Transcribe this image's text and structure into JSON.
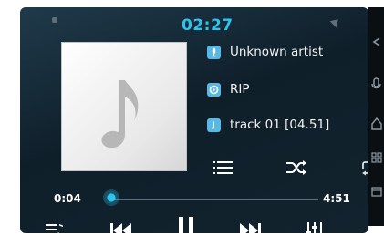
{
  "status": {
    "time": "02:27"
  },
  "track": {
    "artist": "Unknown artist",
    "album": "RIP",
    "title": "track 01 [04.51]"
  },
  "icons": {
    "playlist": "playlist-icon",
    "shuffle": "shuffle-icon",
    "repeat": "repeat-icon",
    "note": "music-note-icon"
  },
  "playback": {
    "elapsed": "0:04",
    "duration": "4:51",
    "progress_fraction": 0.014
  },
  "bottom": {
    "icons": [
      "queue-icon",
      "previous-icon",
      "pause-icon",
      "next-icon",
      "equalizer-icon"
    ]
  },
  "colors": {
    "accent": "#2fc3f0",
    "chip": "#59b9e6"
  }
}
